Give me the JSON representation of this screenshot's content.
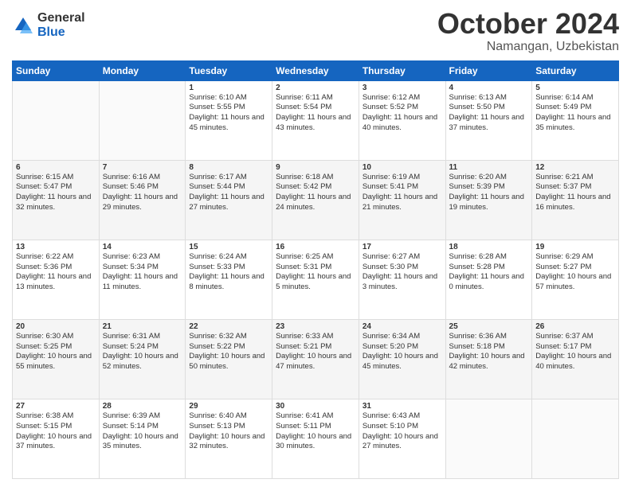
{
  "logo": {
    "general": "General",
    "blue": "Blue"
  },
  "title": "October 2024",
  "location": "Namangan, Uzbekistan",
  "weekdays": [
    "Sunday",
    "Monday",
    "Tuesday",
    "Wednesday",
    "Thursday",
    "Friday",
    "Saturday"
  ],
  "weeks": [
    [
      {
        "day": "",
        "sunrise": "",
        "sunset": "",
        "daylight": ""
      },
      {
        "day": "",
        "sunrise": "",
        "sunset": "",
        "daylight": ""
      },
      {
        "day": "1",
        "sunrise": "Sunrise: 6:10 AM",
        "sunset": "Sunset: 5:55 PM",
        "daylight": "Daylight: 11 hours and 45 minutes."
      },
      {
        "day": "2",
        "sunrise": "Sunrise: 6:11 AM",
        "sunset": "Sunset: 5:54 PM",
        "daylight": "Daylight: 11 hours and 43 minutes."
      },
      {
        "day": "3",
        "sunrise": "Sunrise: 6:12 AM",
        "sunset": "Sunset: 5:52 PM",
        "daylight": "Daylight: 11 hours and 40 minutes."
      },
      {
        "day": "4",
        "sunrise": "Sunrise: 6:13 AM",
        "sunset": "Sunset: 5:50 PM",
        "daylight": "Daylight: 11 hours and 37 minutes."
      },
      {
        "day": "5",
        "sunrise": "Sunrise: 6:14 AM",
        "sunset": "Sunset: 5:49 PM",
        "daylight": "Daylight: 11 hours and 35 minutes."
      }
    ],
    [
      {
        "day": "6",
        "sunrise": "Sunrise: 6:15 AM",
        "sunset": "Sunset: 5:47 PM",
        "daylight": "Daylight: 11 hours and 32 minutes."
      },
      {
        "day": "7",
        "sunrise": "Sunrise: 6:16 AM",
        "sunset": "Sunset: 5:46 PM",
        "daylight": "Daylight: 11 hours and 29 minutes."
      },
      {
        "day": "8",
        "sunrise": "Sunrise: 6:17 AM",
        "sunset": "Sunset: 5:44 PM",
        "daylight": "Daylight: 11 hours and 27 minutes."
      },
      {
        "day": "9",
        "sunrise": "Sunrise: 6:18 AM",
        "sunset": "Sunset: 5:42 PM",
        "daylight": "Daylight: 11 hours and 24 minutes."
      },
      {
        "day": "10",
        "sunrise": "Sunrise: 6:19 AM",
        "sunset": "Sunset: 5:41 PM",
        "daylight": "Daylight: 11 hours and 21 minutes."
      },
      {
        "day": "11",
        "sunrise": "Sunrise: 6:20 AM",
        "sunset": "Sunset: 5:39 PM",
        "daylight": "Daylight: 11 hours and 19 minutes."
      },
      {
        "day": "12",
        "sunrise": "Sunrise: 6:21 AM",
        "sunset": "Sunset: 5:37 PM",
        "daylight": "Daylight: 11 hours and 16 minutes."
      }
    ],
    [
      {
        "day": "13",
        "sunrise": "Sunrise: 6:22 AM",
        "sunset": "Sunset: 5:36 PM",
        "daylight": "Daylight: 11 hours and 13 minutes."
      },
      {
        "day": "14",
        "sunrise": "Sunrise: 6:23 AM",
        "sunset": "Sunset: 5:34 PM",
        "daylight": "Daylight: 11 hours and 11 minutes."
      },
      {
        "day": "15",
        "sunrise": "Sunrise: 6:24 AM",
        "sunset": "Sunset: 5:33 PM",
        "daylight": "Daylight: 11 hours and 8 minutes."
      },
      {
        "day": "16",
        "sunrise": "Sunrise: 6:25 AM",
        "sunset": "Sunset: 5:31 PM",
        "daylight": "Daylight: 11 hours and 5 minutes."
      },
      {
        "day": "17",
        "sunrise": "Sunrise: 6:27 AM",
        "sunset": "Sunset: 5:30 PM",
        "daylight": "Daylight: 11 hours and 3 minutes."
      },
      {
        "day": "18",
        "sunrise": "Sunrise: 6:28 AM",
        "sunset": "Sunset: 5:28 PM",
        "daylight": "Daylight: 11 hours and 0 minutes."
      },
      {
        "day": "19",
        "sunrise": "Sunrise: 6:29 AM",
        "sunset": "Sunset: 5:27 PM",
        "daylight": "Daylight: 10 hours and 57 minutes."
      }
    ],
    [
      {
        "day": "20",
        "sunrise": "Sunrise: 6:30 AM",
        "sunset": "Sunset: 5:25 PM",
        "daylight": "Daylight: 10 hours and 55 minutes."
      },
      {
        "day": "21",
        "sunrise": "Sunrise: 6:31 AM",
        "sunset": "Sunset: 5:24 PM",
        "daylight": "Daylight: 10 hours and 52 minutes."
      },
      {
        "day": "22",
        "sunrise": "Sunrise: 6:32 AM",
        "sunset": "Sunset: 5:22 PM",
        "daylight": "Daylight: 10 hours and 50 minutes."
      },
      {
        "day": "23",
        "sunrise": "Sunrise: 6:33 AM",
        "sunset": "Sunset: 5:21 PM",
        "daylight": "Daylight: 10 hours and 47 minutes."
      },
      {
        "day": "24",
        "sunrise": "Sunrise: 6:34 AM",
        "sunset": "Sunset: 5:20 PM",
        "daylight": "Daylight: 10 hours and 45 minutes."
      },
      {
        "day": "25",
        "sunrise": "Sunrise: 6:36 AM",
        "sunset": "Sunset: 5:18 PM",
        "daylight": "Daylight: 10 hours and 42 minutes."
      },
      {
        "day": "26",
        "sunrise": "Sunrise: 6:37 AM",
        "sunset": "Sunset: 5:17 PM",
        "daylight": "Daylight: 10 hours and 40 minutes."
      }
    ],
    [
      {
        "day": "27",
        "sunrise": "Sunrise: 6:38 AM",
        "sunset": "Sunset: 5:15 PM",
        "daylight": "Daylight: 10 hours and 37 minutes."
      },
      {
        "day": "28",
        "sunrise": "Sunrise: 6:39 AM",
        "sunset": "Sunset: 5:14 PM",
        "daylight": "Daylight: 10 hours and 35 minutes."
      },
      {
        "day": "29",
        "sunrise": "Sunrise: 6:40 AM",
        "sunset": "Sunset: 5:13 PM",
        "daylight": "Daylight: 10 hours and 32 minutes."
      },
      {
        "day": "30",
        "sunrise": "Sunrise: 6:41 AM",
        "sunset": "Sunset: 5:11 PM",
        "daylight": "Daylight: 10 hours and 30 minutes."
      },
      {
        "day": "31",
        "sunrise": "Sunrise: 6:43 AM",
        "sunset": "Sunset: 5:10 PM",
        "daylight": "Daylight: 10 hours and 27 minutes."
      },
      {
        "day": "",
        "sunrise": "",
        "sunset": "",
        "daylight": ""
      },
      {
        "day": "",
        "sunrise": "",
        "sunset": "",
        "daylight": ""
      }
    ]
  ]
}
